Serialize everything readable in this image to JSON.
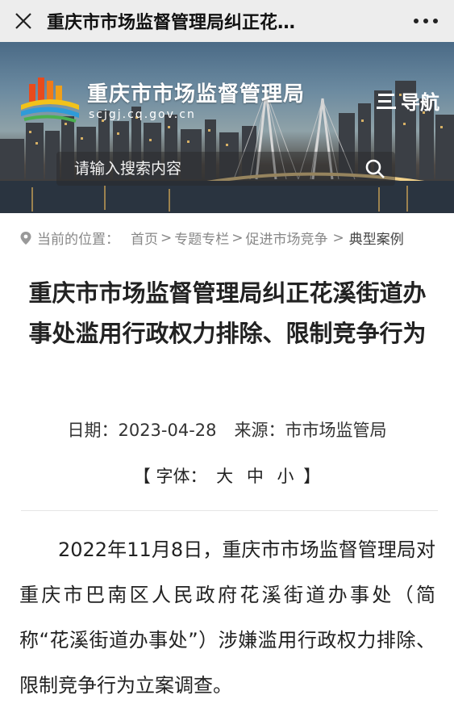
{
  "topbar": {
    "title": "重庆市市场监督管理局纠正花…",
    "close_icon": "close-icon",
    "more_icon": "more-icon"
  },
  "banner": {
    "site_name": "重庆市市场监督管理局",
    "site_domain": "scjgj.cq.gov.cn",
    "nav_label": "导航",
    "search_placeholder": "请输入搜索内容"
  },
  "breadcrumb": {
    "prefix": "当前的位置：",
    "items": [
      "首页",
      "专题专栏",
      "促进市场竞争",
      "典型案例"
    ],
    "separator": ">"
  },
  "article": {
    "title": "重庆市市场监督管理局纠正花溪街道办事处滥用行政权力排除、限制竞争行为",
    "date_label": "日期：",
    "date": "2023-04-28",
    "source_label": "来源：",
    "source": "市市场监管局",
    "font_open": "【",
    "font_label": "字体：",
    "font_large": "大",
    "font_medium": "中",
    "font_small": "小",
    "font_close": "】",
    "paragraph": "2022年11月8日，重庆市市场监督管理局对重庆市巴南区人民政府花溪街道办事处（简称“花溪街道办事处”）涉嫌滥用行政权力排除、限制竞争行为立案调查。"
  }
}
